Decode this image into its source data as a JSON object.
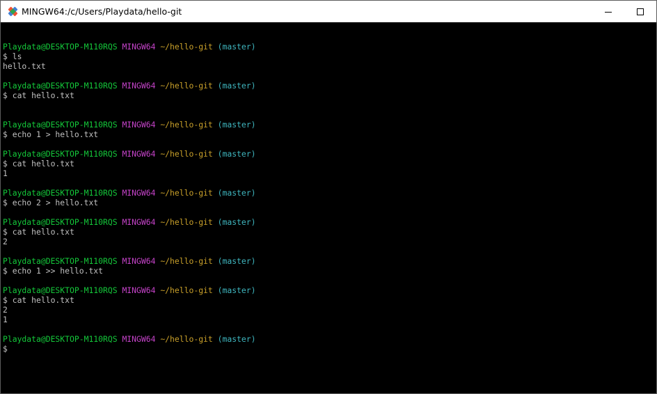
{
  "window": {
    "title": "MINGW64:/c/Users/Playdata/hello-git"
  },
  "icons": {
    "app": "git-bash-icon",
    "minimize": "minimize-icon",
    "maximize": "maximize-icon"
  },
  "colors": {
    "user_host": "#14c93a",
    "env": "#c543c9",
    "path": "#c9a02a",
    "branch": "#3fb7c0",
    "text": "#c0c0c0",
    "background": "#000000"
  },
  "terminal": {
    "lines": [
      {
        "type": "blank"
      },
      {
        "type": "prompt",
        "user": "Playdata@DESKTOP-M110RQS",
        "env": "MINGW64",
        "path": "~/hello-git",
        "branch": "(master)"
      },
      {
        "type": "cmd",
        "text": "$ ls"
      },
      {
        "type": "out",
        "text": "hello.txt"
      },
      {
        "type": "blank"
      },
      {
        "type": "prompt",
        "user": "Playdata@DESKTOP-M110RQS",
        "env": "MINGW64",
        "path": "~/hello-git",
        "branch": "(master)"
      },
      {
        "type": "cmd",
        "text": "$ cat hello.txt"
      },
      {
        "type": "blank"
      },
      {
        "type": "blank"
      },
      {
        "type": "prompt",
        "user": "Playdata@DESKTOP-M110RQS",
        "env": "MINGW64",
        "path": "~/hello-git",
        "branch": "(master)"
      },
      {
        "type": "cmd",
        "text": "$ echo 1 > hello.txt"
      },
      {
        "type": "blank"
      },
      {
        "type": "prompt",
        "user": "Playdata@DESKTOP-M110RQS",
        "env": "MINGW64",
        "path": "~/hello-git",
        "branch": "(master)"
      },
      {
        "type": "cmd",
        "text": "$ cat hello.txt"
      },
      {
        "type": "out",
        "text": "1"
      },
      {
        "type": "blank"
      },
      {
        "type": "prompt",
        "user": "Playdata@DESKTOP-M110RQS",
        "env": "MINGW64",
        "path": "~/hello-git",
        "branch": "(master)"
      },
      {
        "type": "cmd",
        "text": "$ echo 2 > hello.txt"
      },
      {
        "type": "blank"
      },
      {
        "type": "prompt",
        "user": "Playdata@DESKTOP-M110RQS",
        "env": "MINGW64",
        "path": "~/hello-git",
        "branch": "(master)"
      },
      {
        "type": "cmd",
        "text": "$ cat hello.txt"
      },
      {
        "type": "out",
        "text": "2"
      },
      {
        "type": "blank"
      },
      {
        "type": "prompt",
        "user": "Playdata@DESKTOP-M110RQS",
        "env": "MINGW64",
        "path": "~/hello-git",
        "branch": "(master)"
      },
      {
        "type": "cmd",
        "text": "$ echo 1 >> hello.txt"
      },
      {
        "type": "blank"
      },
      {
        "type": "prompt",
        "user": "Playdata@DESKTOP-M110RQS",
        "env": "MINGW64",
        "path": "~/hello-git",
        "branch": "(master)"
      },
      {
        "type": "cmd",
        "text": "$ cat hello.txt"
      },
      {
        "type": "out",
        "text": "2"
      },
      {
        "type": "out",
        "text": "1"
      },
      {
        "type": "blank"
      },
      {
        "type": "prompt",
        "user": "Playdata@DESKTOP-M110RQS",
        "env": "MINGW64",
        "path": "~/hello-git",
        "branch": "(master)"
      },
      {
        "type": "cmd",
        "text": "$"
      }
    ]
  }
}
